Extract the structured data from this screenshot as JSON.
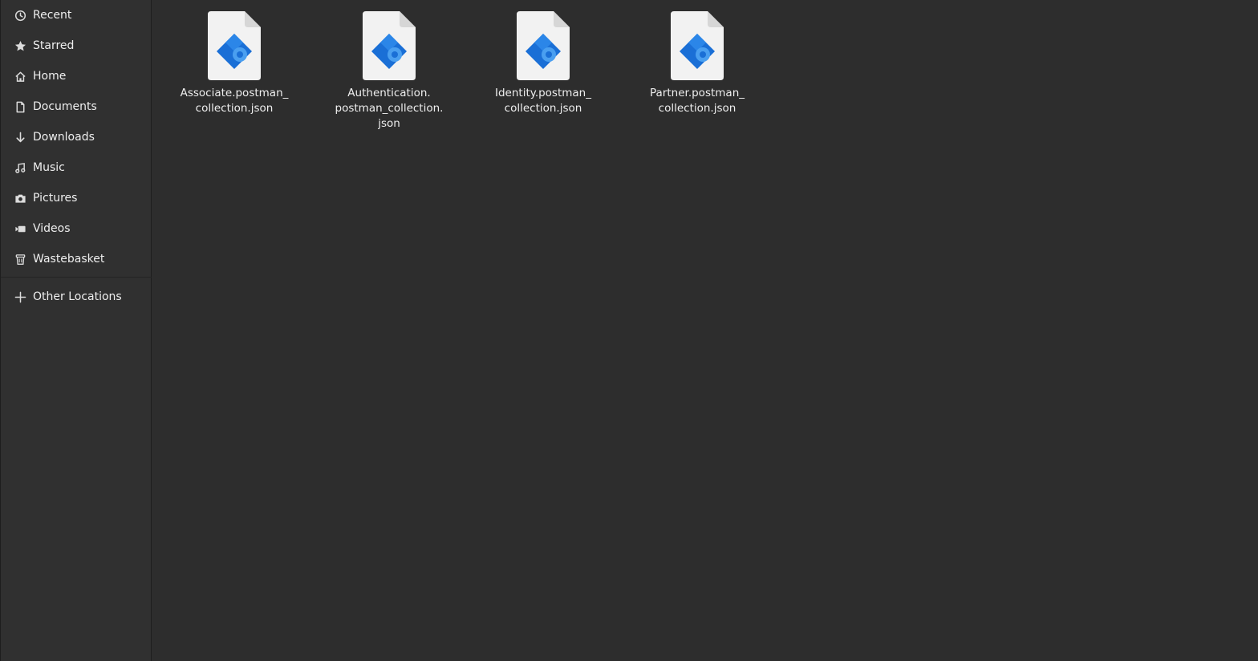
{
  "sidebar": {
    "items": [
      {
        "label": "Recent",
        "icon": "clock-icon"
      },
      {
        "label": "Starred",
        "icon": "star-icon"
      },
      {
        "label": "Home",
        "icon": "home-icon"
      },
      {
        "label": "Documents",
        "icon": "document-icon"
      },
      {
        "label": "Downloads",
        "icon": "download-icon"
      },
      {
        "label": "Music",
        "icon": "music-icon"
      },
      {
        "label": "Pictures",
        "icon": "camera-icon"
      },
      {
        "label": "Videos",
        "icon": "video-icon"
      },
      {
        "label": "Wastebasket",
        "icon": "trash-icon"
      }
    ],
    "other_locations": {
      "label": "Other Locations",
      "icon": "plus-icon"
    }
  },
  "files": [
    {
      "name": "Associate.postman_\ncollection.json",
      "icon": "json-file-icon"
    },
    {
      "name": "Authentication.\npostman_collection.\njson",
      "icon": "json-file-icon"
    },
    {
      "name": "Identity.postman_\ncollection.json",
      "icon": "json-file-icon"
    },
    {
      "name": "Partner.postman_\ncollection.json",
      "icon": "json-file-icon"
    }
  ],
  "colors": {
    "background": "#2d2d2d",
    "sidebar": "#303030",
    "icon_blue": "#1a6fd6",
    "icon_light_blue": "#4a9ff0",
    "page": "#f2f2f2"
  }
}
